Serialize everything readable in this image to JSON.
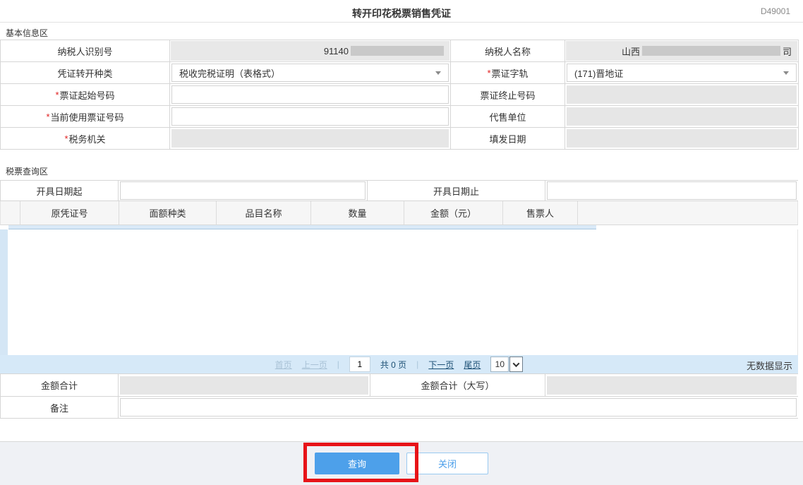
{
  "page": {
    "title": "转开印花税票销售凭证",
    "code": "D49001"
  },
  "required_mark": "*",
  "basic": {
    "section_title": "基本信息区",
    "taxpayer_id_label": "纳税人识别号",
    "taxpayer_id_value": "91140",
    "taxpayer_name_label": "纳税人名称",
    "taxpayer_name_prefix": "山西",
    "taxpayer_name_suffix": "司",
    "voucher_type_label": "凭证转开种类",
    "voucher_type_value": "税收完税证明（表格式）",
    "ticket_track_label": "票证字轨",
    "ticket_track_value": "(171)晋地证",
    "ticket_start_label": "票证起始号码",
    "ticket_end_label": "票证终止号码",
    "current_ticket_label": "当前使用票证号码",
    "agency_label": "代售单位",
    "tax_authority_label": "税务机关",
    "issue_date_label": "填发日期"
  },
  "query": {
    "section_title": "税票查询区",
    "date_from_label": "开具日期起",
    "date_to_label": "开具日期止",
    "columns": [
      "原凭证号",
      "面额种类",
      "品目名称",
      "数量",
      "金额（元）",
      "售票人"
    ],
    "pagination": {
      "first": "首页",
      "prev": "上一页",
      "page_value": "1",
      "total_pages": "共 0 页",
      "next": "下一页",
      "last": "尾页",
      "page_size": "10",
      "empty_text": "无数据显示"
    },
    "total_label": "金额合计",
    "total_cn_label": "金额合计（大写）",
    "remark_label": "备注"
  },
  "footer": {
    "query_label": "查询",
    "close_label": "关闭"
  },
  "colors": {
    "accent_blue": "#4da0ea",
    "pagination_bg": "#d6e9f8",
    "disabled_gray": "#e6e6e6",
    "annotation_red": "#e71318"
  }
}
